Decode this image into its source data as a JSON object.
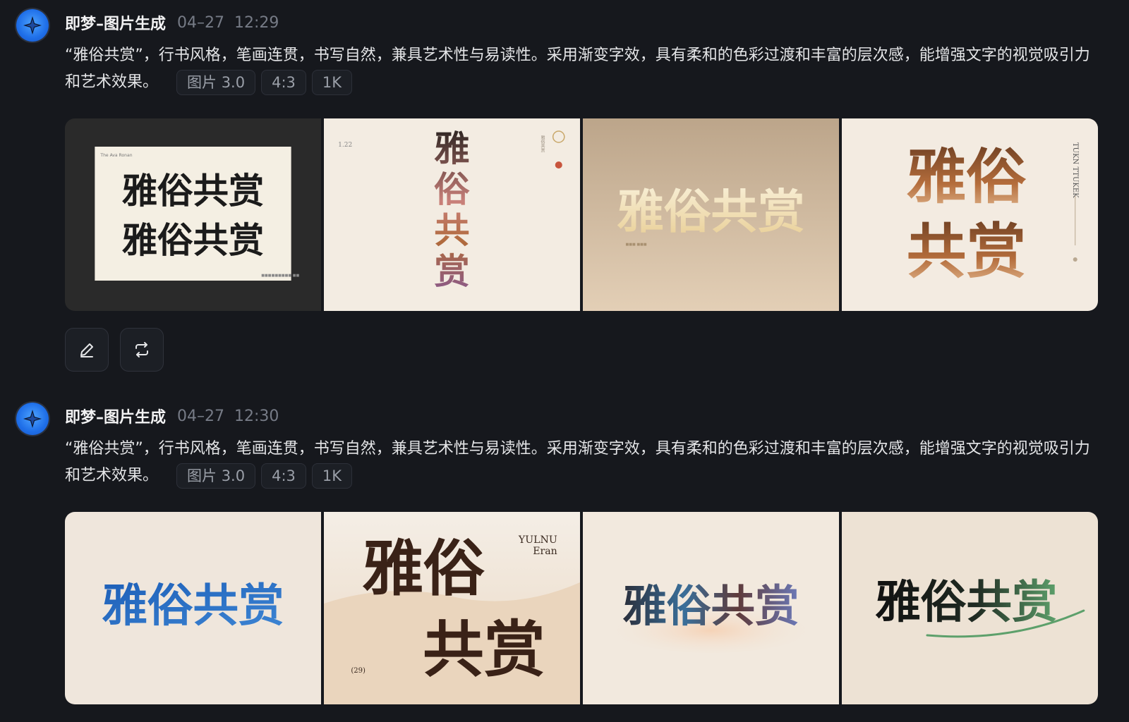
{
  "messages": [
    {
      "sender": "即梦–图片生成",
      "date": "04–27",
      "time": "12:29",
      "prompt": "“雅俗共赏”，行书风格，笔画连贯，书写自然，兼具艺术性与易读性。采用渐变字效，具有柔和的色彩过渡和丰富的层次感，能增强文字的视觉吸引力和艺术效果。",
      "tags": [
        "图片 3.0",
        "4:3",
        "1K"
      ],
      "images": [
        {
          "text": "雅俗共赏",
          "small_text": "The Ava Ronan",
          "footer_text": "■■■■■■■■■ ■■"
        },
        {
          "text": "雅俗共赏",
          "number": "1.22",
          "side_text": "雅俗共赏"
        },
        {
          "text": "雅俗共赏",
          "small_text": "■■■  ■■■"
        },
        {
          "text": "雅俗共赏",
          "side_text": "TUKN TTUKEK"
        }
      ]
    },
    {
      "sender": "即梦–图片生成",
      "date": "04–27",
      "time": "12:30",
      "prompt": "“雅俗共赏”，行书风格，笔画连贯，书写自然，兼具艺术性与易读性。采用渐变字效，具有柔和的色彩过渡和丰富的层次感，能增强文字的视觉吸引力和艺术效果。",
      "tags": [
        "图片 3.0",
        "4:3",
        "1K"
      ],
      "images": [
        {
          "text": "雅俗共赏"
        },
        {
          "text": "雅俗共赏",
          "brand_line1": "YULNU",
          "brand_line2": "Eran",
          "footer_text": "(29)"
        },
        {
          "text": "雅俗共赏"
        },
        {
          "text": "雅俗共赏"
        }
      ]
    }
  ],
  "icons": {
    "avatar": "sparkle-star-icon",
    "edit": "pencil-icon",
    "regenerate": "repeat-arrows-icon"
  },
  "colors": {
    "background": "#16181d",
    "accent": "#1e6ee8",
    "muted_text": "#767b86"
  }
}
